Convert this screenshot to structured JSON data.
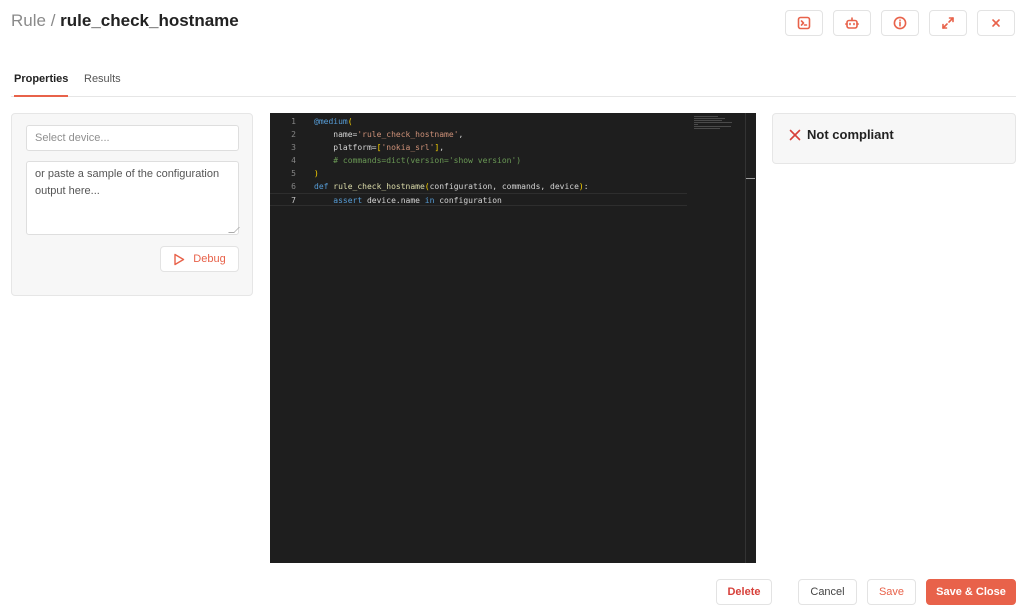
{
  "header": {
    "breadcrumb_parent": "Rule",
    "separator": "/",
    "title": "rule_check_hostname",
    "actions": [
      {
        "name": "terminal-button",
        "icon": "terminal-icon"
      },
      {
        "name": "bot-button",
        "icon": "bot-icon"
      },
      {
        "name": "info-button",
        "icon": "info-icon"
      },
      {
        "name": "expand-button",
        "icon": "expand-icon"
      },
      {
        "name": "close-button",
        "icon": "close-icon"
      }
    ]
  },
  "tabs": [
    {
      "label": "Properties",
      "active": true
    },
    {
      "label": "Results",
      "active": false
    }
  ],
  "debug_panel": {
    "device_placeholder": "Select device...",
    "device_value": "",
    "sample_placeholder": "or paste a sample of the configuration output here...",
    "debug_label": "Debug"
  },
  "editor": {
    "current_line": 7,
    "lines": [
      {
        "n": "1",
        "tokens": [
          {
            "t": "@medium",
            "c": "kw"
          },
          {
            "t": "(",
            "c": "br"
          }
        ]
      },
      {
        "n": "2",
        "tokens": [
          {
            "t": "    name=",
            "c": "id"
          },
          {
            "t": "'rule_check_hostname'",
            "c": "str"
          },
          {
            "t": ",",
            "c": "id"
          }
        ]
      },
      {
        "n": "3",
        "tokens": [
          {
            "t": "    platform=",
            "c": "id"
          },
          {
            "t": "[",
            "c": "br"
          },
          {
            "t": "'nokia_srl'",
            "c": "str"
          },
          {
            "t": "]",
            "c": "br"
          },
          {
            "t": ",",
            "c": "id"
          }
        ]
      },
      {
        "n": "4",
        "tokens": [
          {
            "t": "    # commands=dict(version='show version')",
            "c": "cm"
          }
        ]
      },
      {
        "n": "5",
        "tokens": [
          {
            "t": ")",
            "c": "br"
          }
        ]
      },
      {
        "n": "6",
        "tokens": [
          {
            "t": "def ",
            "c": "kw"
          },
          {
            "t": "rule_check_hostname",
            "c": "fn"
          },
          {
            "t": "(",
            "c": "br"
          },
          {
            "t": "configuration, commands, device",
            "c": "id"
          },
          {
            "t": ")",
            "c": "br"
          },
          {
            "t": ":",
            "c": "id"
          }
        ]
      },
      {
        "n": "7",
        "tokens": [
          {
            "t": "    ",
            "c": "id"
          },
          {
            "t": "assert ",
            "c": "kw"
          },
          {
            "t": "device.name ",
            "c": "id"
          },
          {
            "t": "in ",
            "c": "kw"
          },
          {
            "t": "configuration",
            "c": "id"
          }
        ]
      }
    ]
  },
  "result": {
    "status": "Not compliant",
    "icon": "x-icon",
    "color": "#d7403a"
  },
  "footer": {
    "delete_label": "Delete",
    "cancel_label": "Cancel",
    "save_label": "Save",
    "save_close_label": "Save & Close"
  },
  "colors": {
    "accent": "#e8624a",
    "danger": "#d7403a",
    "editor_bg": "#1e1e1e"
  }
}
